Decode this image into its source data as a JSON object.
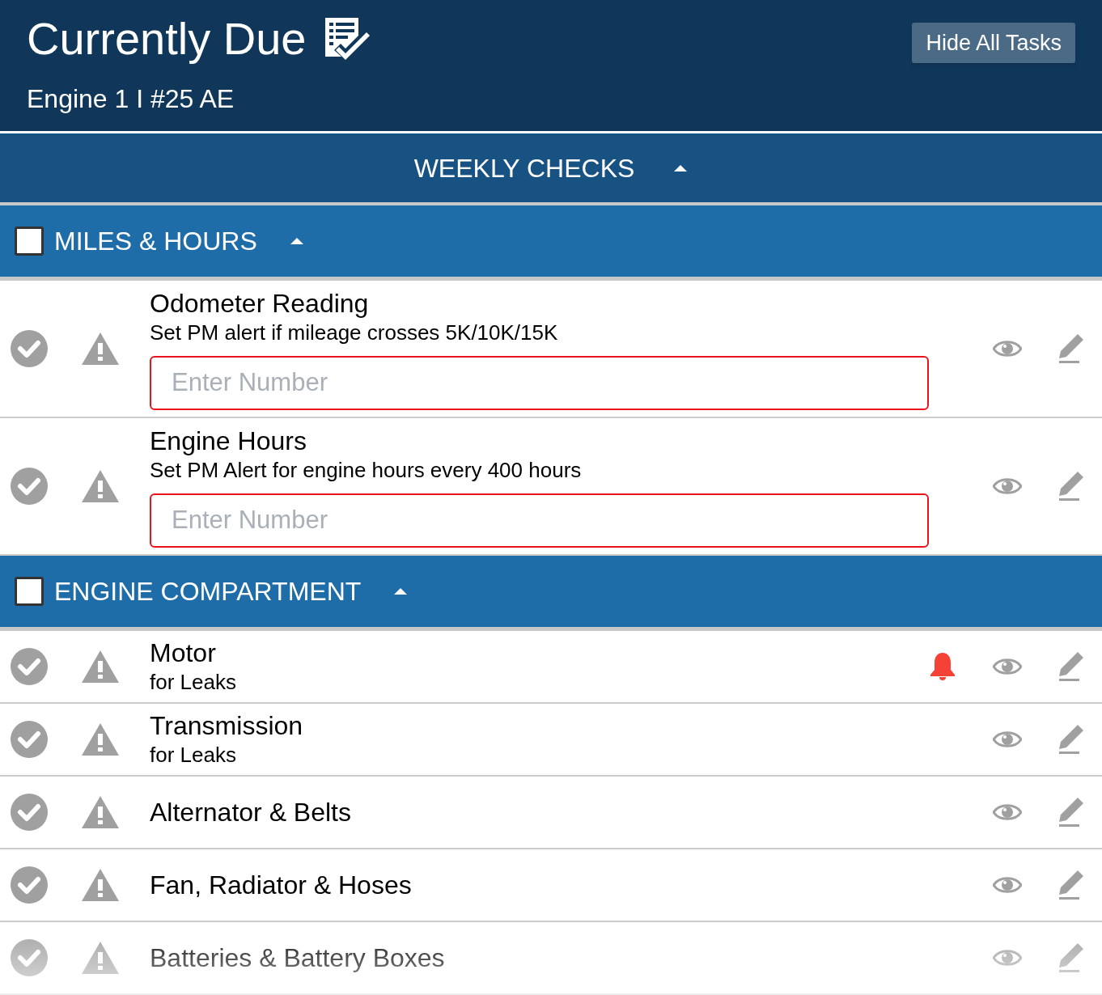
{
  "header": {
    "title": "Currently Due",
    "subtitle": "Engine 1 I #25 AE",
    "button": "Hide All Tasks"
  },
  "group": {
    "title": "WEEKLY CHECKS",
    "expanded": true
  },
  "sections": [
    {
      "title": "MILES & HOURS",
      "checked": false,
      "expanded": true,
      "tasks": [
        {
          "title": "Odometer Reading",
          "subtitle": "Set PM alert if mileage crosses 5K/10K/15K",
          "placeholder": "Enter Number",
          "alert": false
        },
        {
          "title": "Engine Hours",
          "subtitle": "Set PM Alert for engine hours every 400 hours",
          "placeholder": "Enter Number",
          "alert": false
        }
      ]
    },
    {
      "title": "ENGINE COMPARTMENT",
      "checked": false,
      "expanded": true,
      "tasks": [
        {
          "title": "Motor",
          "subtitle": "for Leaks",
          "alert": true
        },
        {
          "title": "Transmission",
          "subtitle": "for Leaks",
          "alert": false
        },
        {
          "title": "Alternator & Belts",
          "alert": false
        },
        {
          "title": "Fan, Radiator & Hoses",
          "alert": false
        },
        {
          "title": "Batteries & Battery Boxes",
          "alert": false
        }
      ]
    }
  ]
}
